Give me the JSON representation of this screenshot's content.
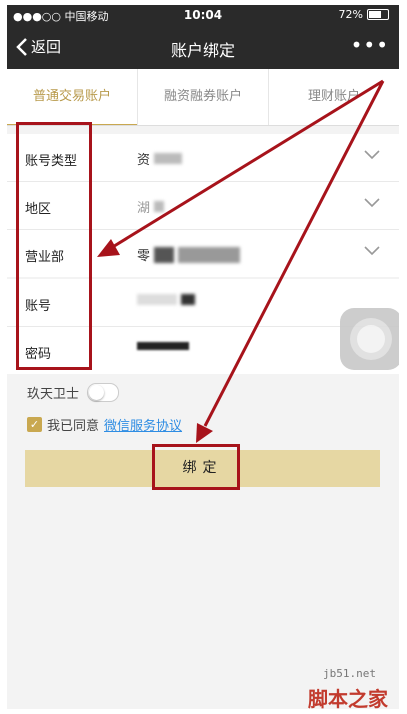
{
  "status_bar": {
    "carrier": "●●●○○ 中国移动",
    "time": "10:04",
    "battery": "72%",
    "battery_level": 0.72
  },
  "nav": {
    "back_label": "返回",
    "title": "账户绑定",
    "more": "•••"
  },
  "tabs": [
    {
      "label": "普通交易账户",
      "active": true
    },
    {
      "label": "融资融券账户",
      "active": false
    },
    {
      "label": "理财账户",
      "active": false
    }
  ],
  "form": {
    "account_type": {
      "label": "账号类型",
      "value": "资"
    },
    "region": {
      "label": "地区",
      "value": "湖"
    },
    "branch": {
      "label": "营业部",
      "value": "零"
    },
    "account": {
      "label": "账号"
    },
    "password": {
      "label": "密码"
    }
  },
  "guard": {
    "label": "玖天卫士",
    "enabled": false
  },
  "agreement": {
    "prefix": "我已同意",
    "link": "微信服务协议",
    "checked": true
  },
  "bind_button": {
    "label": "绑定"
  },
  "watermark": {
    "site": "jb51.net",
    "name": "脚本之家"
  },
  "colors": {
    "accent": "#c9a850",
    "button": "#e6d7a3",
    "annotation": "#a7131b",
    "link": "#2f8de3",
    "navbar": "#2a2a2a"
  }
}
